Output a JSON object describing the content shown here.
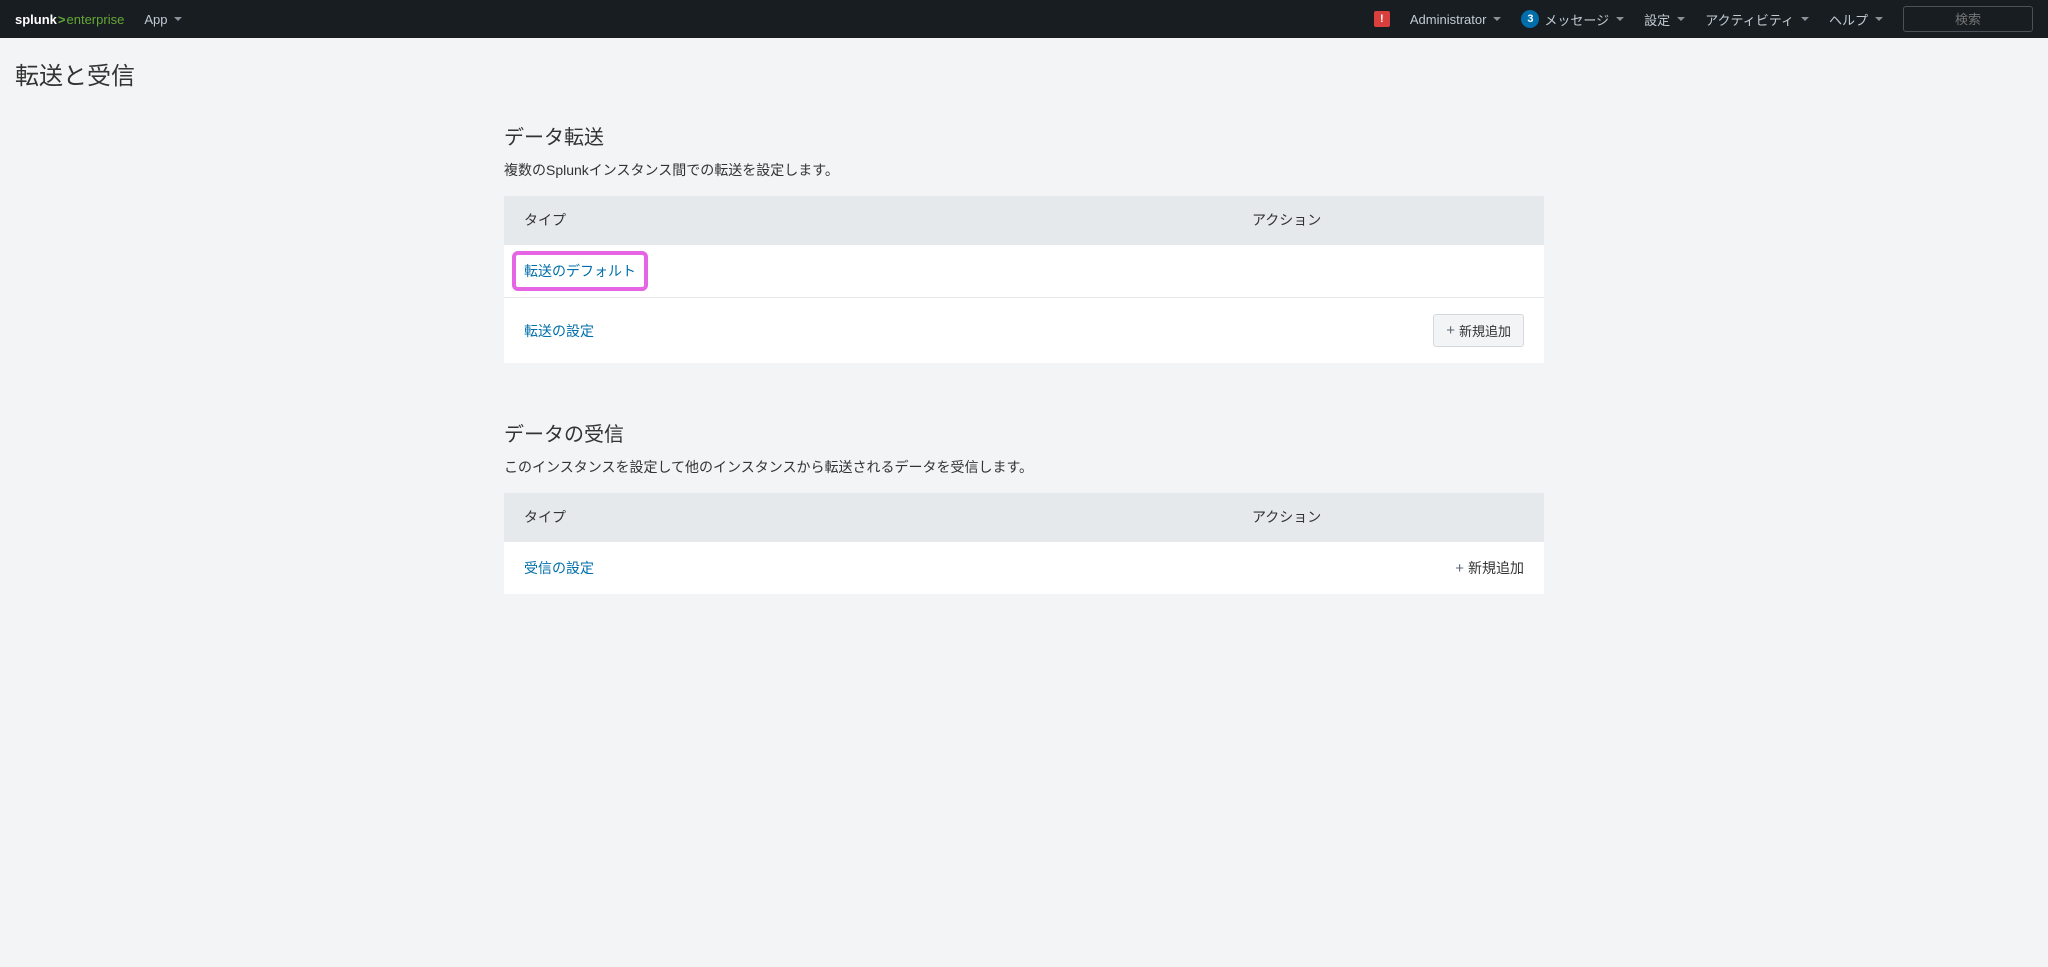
{
  "topbar": {
    "logo": {
      "splunk": "splunk",
      "gt": ">",
      "enterprise": "enterprise"
    },
    "app_label": "App",
    "warning_glyph": "!",
    "admin_label": "Administrator",
    "messages_badge": "3",
    "messages_label": "メッセージ",
    "settings_label": "設定",
    "activity_label": "アクティビティ",
    "help_label": "ヘルプ",
    "search_placeholder": "検索"
  },
  "page": {
    "title": "転送と受信"
  },
  "sections": [
    {
      "title": "データ転送",
      "description": "複数のSplunkインスタンス間での転送を設定します。",
      "header_type": "タイプ",
      "header_action": "アクション",
      "rows": [
        {
          "label": "転送のデフォルト",
          "highlight": true,
          "action": null
        },
        {
          "label": "転送の設定",
          "highlight": false,
          "action": "新規追加",
          "action_style": "button"
        }
      ]
    },
    {
      "title": "データの受信",
      "description": "このインスタンスを設定して他のインスタンスから転送されるデータを受信します。",
      "header_type": "タイプ",
      "header_action": "アクション",
      "rows": [
        {
          "label": "受信の設定",
          "highlight": false,
          "action": "新規追加",
          "action_style": "plain"
        }
      ]
    }
  ]
}
